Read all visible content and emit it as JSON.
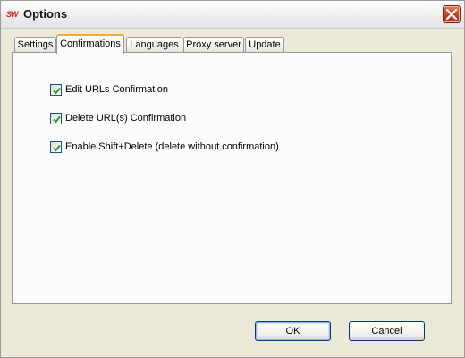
{
  "window": {
    "title": "Options",
    "app_icon_text": "SW",
    "close_icon": "close-icon",
    "accent_close": "#c4401f"
  },
  "tabs": [
    {
      "label": "Settings",
      "active": false
    },
    {
      "label": "Confirmations",
      "active": true
    },
    {
      "label": "Languages",
      "active": false
    },
    {
      "label": "Proxy server",
      "active": false
    },
    {
      "label": "Update",
      "active": false
    }
  ],
  "options": [
    {
      "label": "Edit URLs Confirmation",
      "checked": true
    },
    {
      "label": "Delete URL(s) Confirmation",
      "checked": true
    },
    {
      "label": "Enable Shift+Delete (delete without confirmation)",
      "checked": true
    }
  ],
  "buttons": {
    "ok": "OK",
    "cancel": "Cancel"
  },
  "colors": {
    "checkmark": "#21a121",
    "active_tab_highlight": "#f0a93b"
  }
}
